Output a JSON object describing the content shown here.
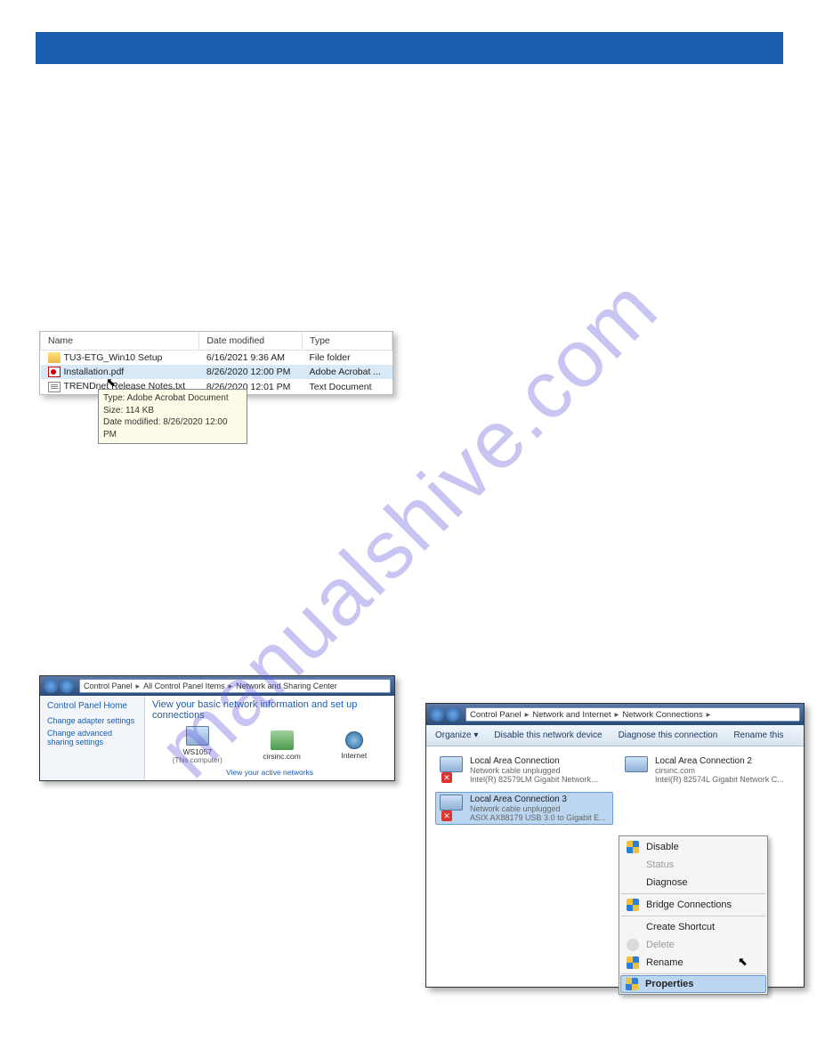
{
  "watermark": "manualshive.com",
  "shot1": {
    "headers": {
      "name": "Name",
      "date": "Date modified",
      "type": "Type"
    },
    "rows": [
      {
        "name": "TU3-ETG_Win10 Setup",
        "date": "6/16/2021 9:36 AM",
        "type": "File folder"
      },
      {
        "name": "Installation.pdf",
        "date": "8/26/2020 12:00 PM",
        "type": "Adobe Acrobat ..."
      },
      {
        "name": "TRENDnet Release Notes.txt",
        "date": "8/26/2020 12:01 PM",
        "type": "Text Document"
      }
    ],
    "tooltip": {
      "l1": "Type: Adobe Acrobat Document",
      "l2": "Size: 114 KB",
      "l3": "Date modified: 8/26/2020 12:00 PM"
    }
  },
  "shot2": {
    "breadcrumb": {
      "a": "Control Panel",
      "b": "All Control Panel Items",
      "c": "Network and Sharing Center"
    },
    "side": {
      "home": "Control Panel Home",
      "l1": "Change adapter settings",
      "l2": "Change advanced sharing settings"
    },
    "heading": "View your basic network information and set up connections",
    "items": {
      "pc": "WS1057",
      "pcsub": "(This computer)",
      "net": "cirsinc.com",
      "inet": "Internet"
    },
    "viewline": "View your active networks"
  },
  "shot3": {
    "breadcrumb": {
      "a": "Control Panel",
      "b": "Network and Internet",
      "c": "Network Connections"
    },
    "toolbar": {
      "org": "Organize",
      "dis": "Disable this network device",
      "diag": "Diagnose this connection",
      "ren": "Rename this"
    },
    "conns": [
      {
        "name": "Local Area Connection",
        "status": "Network cable unplugged",
        "dev": "Intel(R) 82579LM Gigabit Network..."
      },
      {
        "name": "Local Area Connection 2",
        "status": "cirsinc.com",
        "dev": "Intel(R) 82574L Gigabit Network C..."
      },
      {
        "name": "Local Area Connection 3",
        "status": "Network cable unplugged",
        "dev": "ASIX AX88179 USB 3.0 to Gigabit E..."
      }
    ],
    "ctx": {
      "disable": "Disable",
      "status": "Status",
      "diagnose": "Diagnose",
      "bridge": "Bridge Connections",
      "shortcut": "Create Shortcut",
      "delete": "Delete",
      "rename": "Rename",
      "properties": "Properties"
    }
  }
}
